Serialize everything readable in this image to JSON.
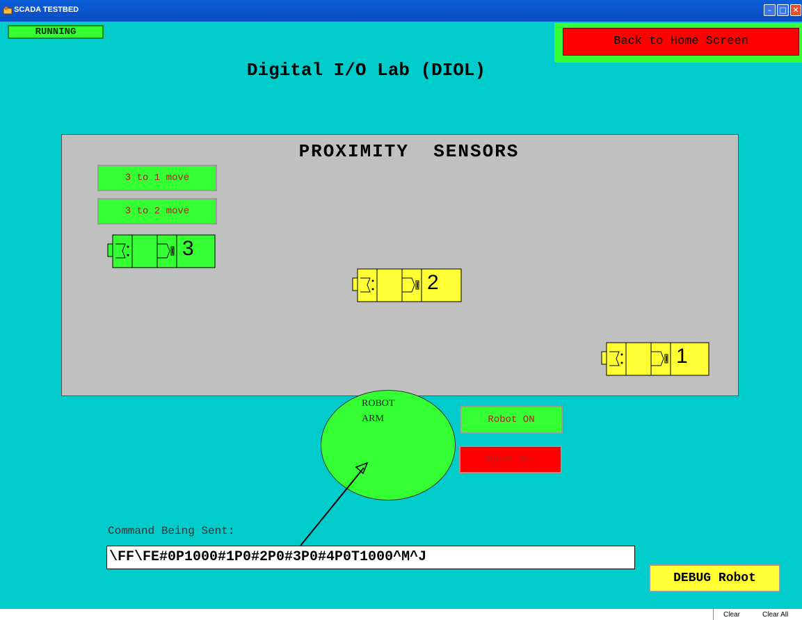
{
  "window": {
    "title": "SCADA TESTBED"
  },
  "status": {
    "label": "RUNNING"
  },
  "home_button": {
    "label": "Back to Home Screen"
  },
  "page_title": "Digital I/O Lab (DIOL)",
  "panel": {
    "title": "PROXIMITY  SENSORS",
    "move_buttons": [
      {
        "label": "3 to 1 move"
      },
      {
        "label": "3 to 2 move"
      }
    ],
    "sensors": [
      {
        "number": "3",
        "color": "#33ff33"
      },
      {
        "number": "2",
        "color": "#ffff33"
      },
      {
        "number": "1",
        "color": "#ffff33"
      }
    ]
  },
  "robot": {
    "arm_label_line1": "ROBOT",
    "arm_label_line2": "ARM",
    "on_label": "Robot ON",
    "off_label": "Robot OFF"
  },
  "command": {
    "label": "Command Being Sent:",
    "value": "\\FF\\FE#0P1000#1P0#2P0#3P0#4P0T1000^M^J"
  },
  "debug_button": {
    "label": "DEBUG Robot"
  },
  "bottom": {
    "clear_label": "Clear",
    "clear_all_label": "Clear All"
  },
  "colors": {
    "background": "#00cccc",
    "on_green": "#33ff33",
    "off_red": "#ff0000",
    "sensor_yellow": "#ffff33"
  }
}
